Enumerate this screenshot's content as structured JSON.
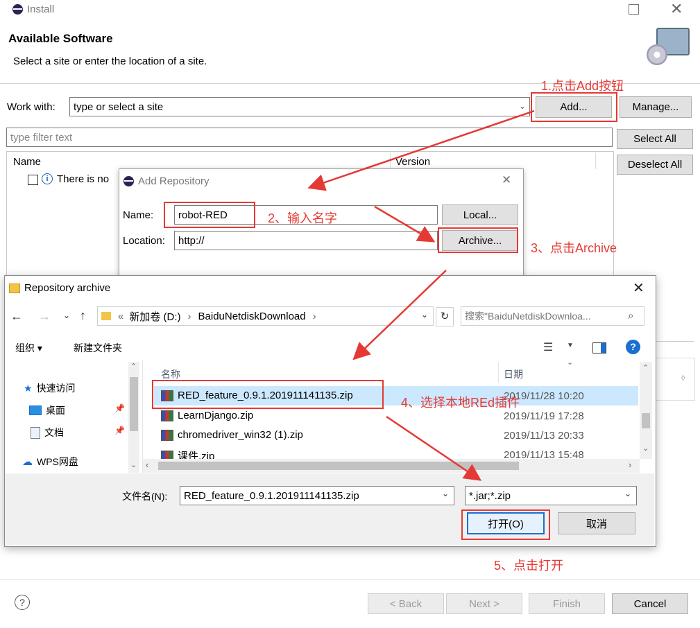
{
  "install": {
    "title": "Install",
    "heading": "Available Software",
    "subheading": "Select a site or enter the location of a site.",
    "work_with_label": "Work with:",
    "work_with_value": "type or select a site",
    "add_button": "Add...",
    "manage_button": "Manage...",
    "filter_placeholder": "type filter text",
    "select_all": "Select All",
    "deselect_all": "Deselect All",
    "col_name": "Name",
    "col_version": "Version",
    "row_text": "There is no",
    "back_button": "< Back",
    "next_button": "Next >",
    "finish_button": "Finish",
    "cancel_button": "Cancel"
  },
  "add_repo": {
    "title": "Add Repository",
    "name_label": "Name:",
    "name_value": "robot-RED",
    "location_label": "Location:",
    "location_value": "http://",
    "local_button": "Local...",
    "archive_button": "Archive..."
  },
  "archive": {
    "title": "Repository archive",
    "path": [
      "新加卷 (D:)",
      "BaiduNetdiskDownload"
    ],
    "search_placeholder": "搜索\"BaiduNetdiskDownloa...",
    "organize": "组织 ▾",
    "new_folder": "新建文件夹",
    "nav": [
      {
        "label": "快速访问"
      },
      {
        "label": "桌面"
      },
      {
        "label": "文档"
      },
      {
        "label": "WPS网盘"
      }
    ],
    "col_name": "名称",
    "col_date": "日期",
    "files": [
      {
        "name": "RED_feature_0.9.1.201911141135.zip",
        "date": "2019/11/28 10:20"
      },
      {
        "name": "LearnDjango.zip",
        "date": "2019/11/19 17:28"
      },
      {
        "name": "chromedriver_win32 (1).zip",
        "date": "2019/11/13 20:33"
      },
      {
        "name": "课件.zip",
        "date": "2019/11/13 15:48"
      }
    ],
    "filename_label": "文件名(N):",
    "filename_value": "RED_feature_0.9.1.201911141135.zip",
    "filter_value": "*.jar;*.zip",
    "open_button": "打开(O)",
    "cancel_button": "取消"
  },
  "annotations": {
    "step1": "1.点击Add按钮",
    "step2": "2、输入名字",
    "step3": "3、点击Archive",
    "step4": "4、选择本地REd插件",
    "step5": "5、点击打开"
  },
  "colors": {
    "accent": "#e53935",
    "selection": "#cce8ff"
  }
}
